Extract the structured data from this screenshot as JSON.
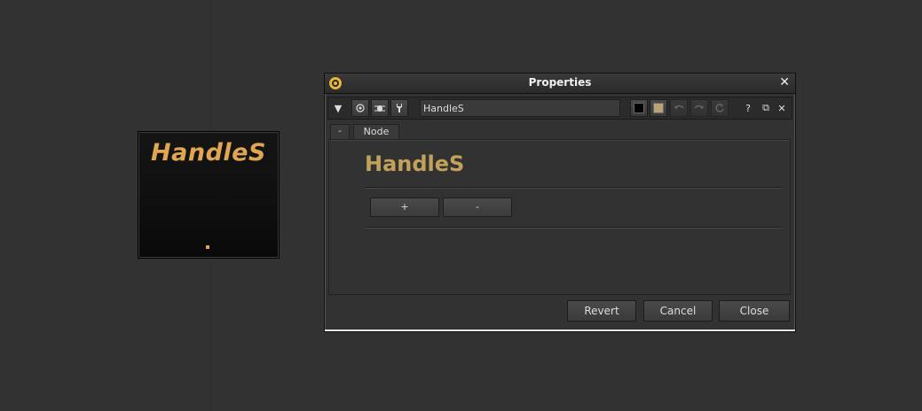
{
  "node": {
    "title": "HandleS",
    "dot": "."
  },
  "window": {
    "title": "Properties",
    "close_symbol": "✕"
  },
  "toolbar": {
    "collapse_symbol": "▼",
    "name_value": "HandleS",
    "help_symbol": "?",
    "float_symbol": "⧉",
    "close_symbol": "✕"
  },
  "tabs": {
    "minus_label": "-",
    "node_label": "Node"
  },
  "panel": {
    "node_name": "HandleS",
    "plus_label": "+",
    "minus_label": "-"
  },
  "footer": {
    "revert_label": "Revert",
    "cancel_label": "Cancel",
    "close_label": "Close"
  },
  "colors": {
    "node_title": "#e0a650",
    "panel_title": "#c2a25a",
    "accent_logo": "#e7b63f",
    "tile_color": "#b8a276"
  }
}
